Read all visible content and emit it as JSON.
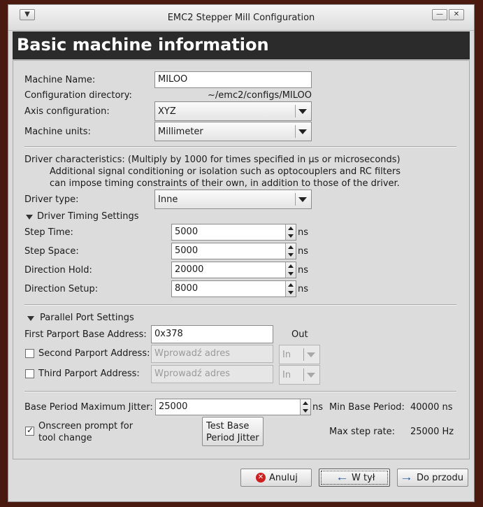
{
  "window": {
    "title": "EMC2 Stepper Mill Configuration",
    "menu_icon": "menu-icon",
    "minimize_icon": "minimize-icon",
    "close_icon": "close-icon"
  },
  "banner": {
    "title": "Basic machine information"
  },
  "machine": {
    "name_label": "Machine Name:",
    "name_value": "MILOO",
    "config_dir_label": "Configuration directory:",
    "config_dir_value": "~/emc2/configs/MILOO",
    "axis_label": "Axis configuration:",
    "axis_value": "XYZ",
    "units_label": "Machine units:",
    "units_value": "Millimeter"
  },
  "driver": {
    "desc_line1": "Driver characteristics: (Multiply by 1000 for times specified in µs or microseconds)",
    "desc_line2": "Additional signal conditioning or isolation such as optocouplers and RC filters",
    "desc_line3": "can impose timing constraints of their own, in addition to those of the driver.",
    "type_label": "Driver type:",
    "type_value": "Inne",
    "timing_header": "Driver Timing Settings",
    "unit": "ns",
    "step_time_label": "Step Time:",
    "step_time_value": "5000",
    "step_space_label": "Step Space:",
    "step_space_value": "5000",
    "dir_hold_label": "Direction Hold:",
    "dir_hold_value": "20000",
    "dir_setup_label": "Direction Setup:",
    "dir_setup_value": "8000"
  },
  "parport": {
    "header": "Parallel Port Settings",
    "first_label": "First Parport Base Address:",
    "first_value": "0x378",
    "first_dir": "Out",
    "second_label": "Second Parport Address:",
    "second_placeholder": "Wprowadź adres",
    "second_dir": "In",
    "third_label": "Third Parport Address:",
    "third_placeholder": "Wprowadź adres",
    "third_dir": "In"
  },
  "jitter": {
    "label": "Base Period Maximum Jitter:",
    "value": "25000",
    "unit": "ns",
    "min_period_label": "Min Base Period:",
    "min_period_value": "40000 ns",
    "max_step_label": "Max step rate:",
    "max_step_value": "25000 Hz",
    "prompt_line1": "Onscreen prompt for",
    "prompt_line2": "tool change",
    "prompt_checked": true,
    "test_line1": "Test Base",
    "test_line2": "Period Jitter"
  },
  "buttons": {
    "cancel": "Anuluj",
    "back": "W tył",
    "forward": "Do przodu"
  },
  "colors": {
    "banner_bg": "#2b2b2b",
    "cancel_icon": "#cc1f1f",
    "arrow_icon": "#3465a4"
  }
}
